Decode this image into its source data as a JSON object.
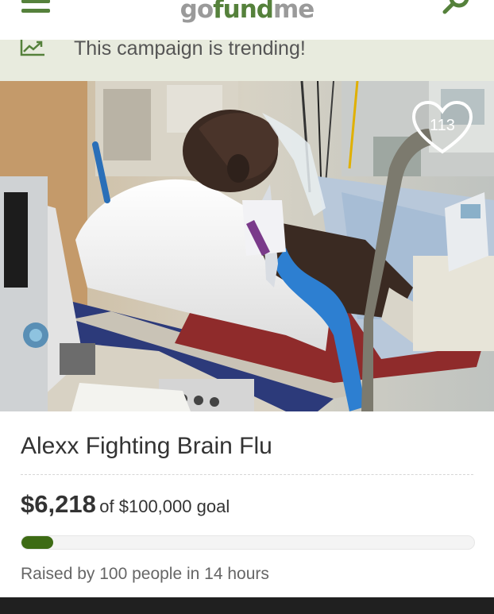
{
  "header": {
    "logo_part1": "go",
    "logo_part2": "fund",
    "logo_part3": "me",
    "menu_icon": "hamburger-icon",
    "search_icon": "search-icon",
    "brand_color": "#55813b"
  },
  "banner": {
    "text": "This campaign is trending!",
    "icon": "trending-chart-icon"
  },
  "campaign": {
    "hearts": "113",
    "title": "Alexx Fighting Brain Flu",
    "raised_amount": "$6,218",
    "goal_text": "of $100,000 goal",
    "progress_fraction": 0.06218,
    "raised_text": "Raised by 100 people in 14 hours"
  }
}
